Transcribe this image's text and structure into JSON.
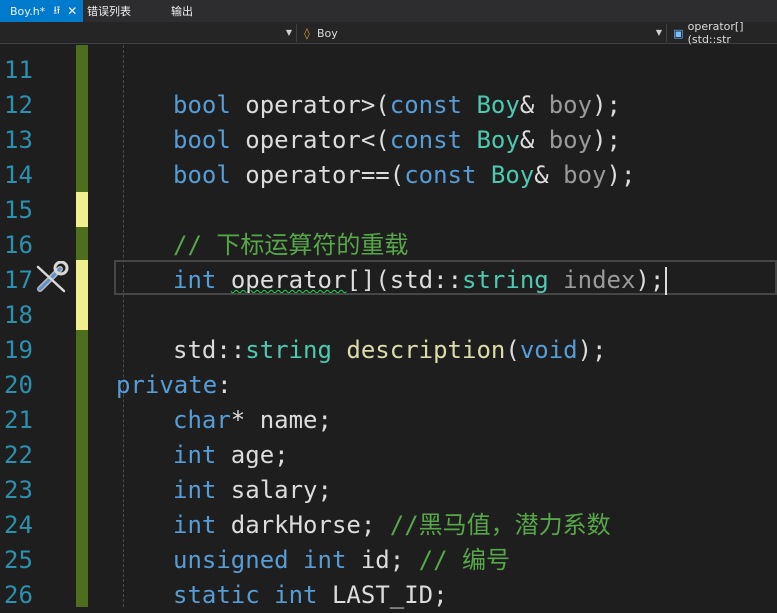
{
  "tabs": [
    {
      "label": "Boy.h*",
      "pin": "⭿",
      "close": "✕",
      "active": true
    },
    {
      "label": "错误列表"
    },
    {
      "label": "输出"
    }
  ],
  "navbar": {
    "project": "",
    "scope": "Boy",
    "member": "operator[](std::str"
  },
  "lines": [
    {
      "no": "11"
    },
    {
      "no": "12"
    },
    {
      "no": "13"
    },
    {
      "no": "14"
    },
    {
      "no": "15"
    },
    {
      "no": "16"
    },
    {
      "no": "17"
    },
    {
      "no": "18"
    },
    {
      "no": "19"
    },
    {
      "no": "20"
    },
    {
      "no": "21"
    },
    {
      "no": "22"
    },
    {
      "no": "23"
    },
    {
      "no": "24"
    },
    {
      "no": "25"
    },
    {
      "no": "26"
    }
  ],
  "code": {
    "bool": "bool",
    "const": "const",
    "boy_type": "Boy",
    "amp": "&",
    "param_boy": "boy",
    "op_gt": " operator>(",
    "op_lt": " operator<(",
    "op_eq": " operator==(",
    "close_semi": ");",
    "comment_overload": "// 下标运算符的重载",
    "int": "int",
    "operator_word": "operator",
    "brackets": "[]",
    "std": "std::",
    "string": "string",
    "index": "index",
    "description": "description",
    "void": "void",
    "private": "private",
    "colon": ":",
    "char": "char",
    "name_decl": "* name;",
    "age_decl": " age;",
    "salary_decl": " salary;",
    "darkhorse_decl": " darkHorse; ",
    "comment_darkhorse": "//黑马值，潜力系数",
    "unsigned": "unsigned",
    "id_decl": " id; ",
    "comment_id": "// 编号",
    "static": "static",
    "lastid_decl": " LAST_ID;"
  },
  "colors": {
    "keyword": "#569cd6",
    "type": "#4ec9b0",
    "function": "#dcdcaa",
    "comment": "#57a64a",
    "line_number": "#2b91af",
    "change_saved": "#4f6e1d",
    "change_unsaved": "#efef90",
    "active_tab": "#007acc"
  },
  "icons": {
    "tab_pin": "pin-icon",
    "tab_close": "close-icon",
    "scope_class": "class-icon",
    "member_method": "method-icon",
    "quick_action": "wrench-screwdriver-icon"
  }
}
